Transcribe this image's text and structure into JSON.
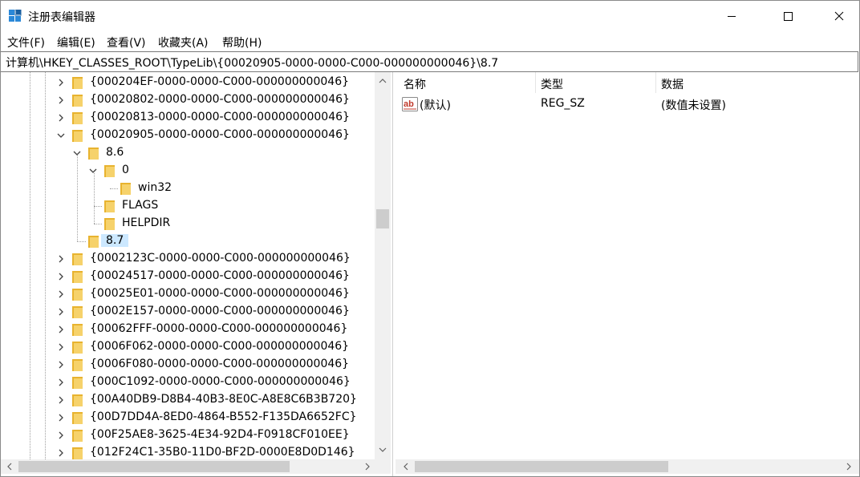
{
  "window": {
    "title": "注册表编辑器"
  },
  "menu": [
    "文件(F)",
    "编辑(E)",
    "查看(V)",
    "收藏夹(A)",
    "帮助(H)"
  ],
  "address": "计算机\\HKEY_CLASSES_ROOT\\TypeLib\\{00020905-0000-0000-C000-000000000046}\\8.7",
  "tree": [
    {
      "label": "{000204EF-0000-0000-C000-000000000046}",
      "expander": "collapsed"
    },
    {
      "label": "{00020802-0000-0000-C000-000000000046}",
      "expander": "collapsed"
    },
    {
      "label": "{00020813-0000-0000-C000-000000000046}",
      "expander": "collapsed"
    },
    {
      "label": "{00020905-0000-0000-C000-000000000046}",
      "expander": "expanded"
    },
    {
      "label": "8.6",
      "expander": "expanded"
    },
    {
      "label": "0",
      "expander": "expanded"
    },
    {
      "label": "win32",
      "expander": "none"
    },
    {
      "label": "FLAGS",
      "expander": "none"
    },
    {
      "label": "HELPDIR",
      "expander": "none"
    },
    {
      "label": "8.7",
      "expander": "none",
      "selected": true
    },
    {
      "label": "{0002123C-0000-0000-C000-000000000046}",
      "expander": "collapsed"
    },
    {
      "label": "{00024517-0000-0000-C000-000000000046}",
      "expander": "collapsed"
    },
    {
      "label": "{00025E01-0000-0000-C000-000000000046}",
      "expander": "collapsed"
    },
    {
      "label": "{0002E157-0000-0000-C000-000000000046}",
      "expander": "collapsed"
    },
    {
      "label": "{00062FFF-0000-0000-C000-000000000046}",
      "expander": "collapsed"
    },
    {
      "label": "{0006F062-0000-0000-C000-000000000046}",
      "expander": "collapsed"
    },
    {
      "label": "{0006F080-0000-0000-C000-000000000046}",
      "expander": "collapsed"
    },
    {
      "label": "{000C1092-0000-0000-C000-000000000046}",
      "expander": "collapsed"
    },
    {
      "label": "{00A40DB9-D8B4-40B3-8E0C-A8E8C6B3B720}",
      "expander": "collapsed"
    },
    {
      "label": "{00D7DD4A-8ED0-4864-B552-F135DA6652FC}",
      "expander": "collapsed"
    },
    {
      "label": "{00F25AE8-3625-4E34-92D4-F0918CF010EE}",
      "expander": "collapsed"
    },
    {
      "label": "{012F24C1-35B0-11D0-BF2D-0000E8D0D146}",
      "expander": "collapsed"
    }
  ],
  "list": {
    "columns": [
      "名称",
      "类型",
      "数据"
    ],
    "rows": [
      {
        "icon": "ab-string-icon",
        "name": "(默认)",
        "type": "REG_SZ",
        "data": "(数值未设置)"
      }
    ]
  },
  "colors": {
    "selection": "#cce8ff",
    "folder": "#e8b32f",
    "folder_light": "#f6d26b"
  }
}
